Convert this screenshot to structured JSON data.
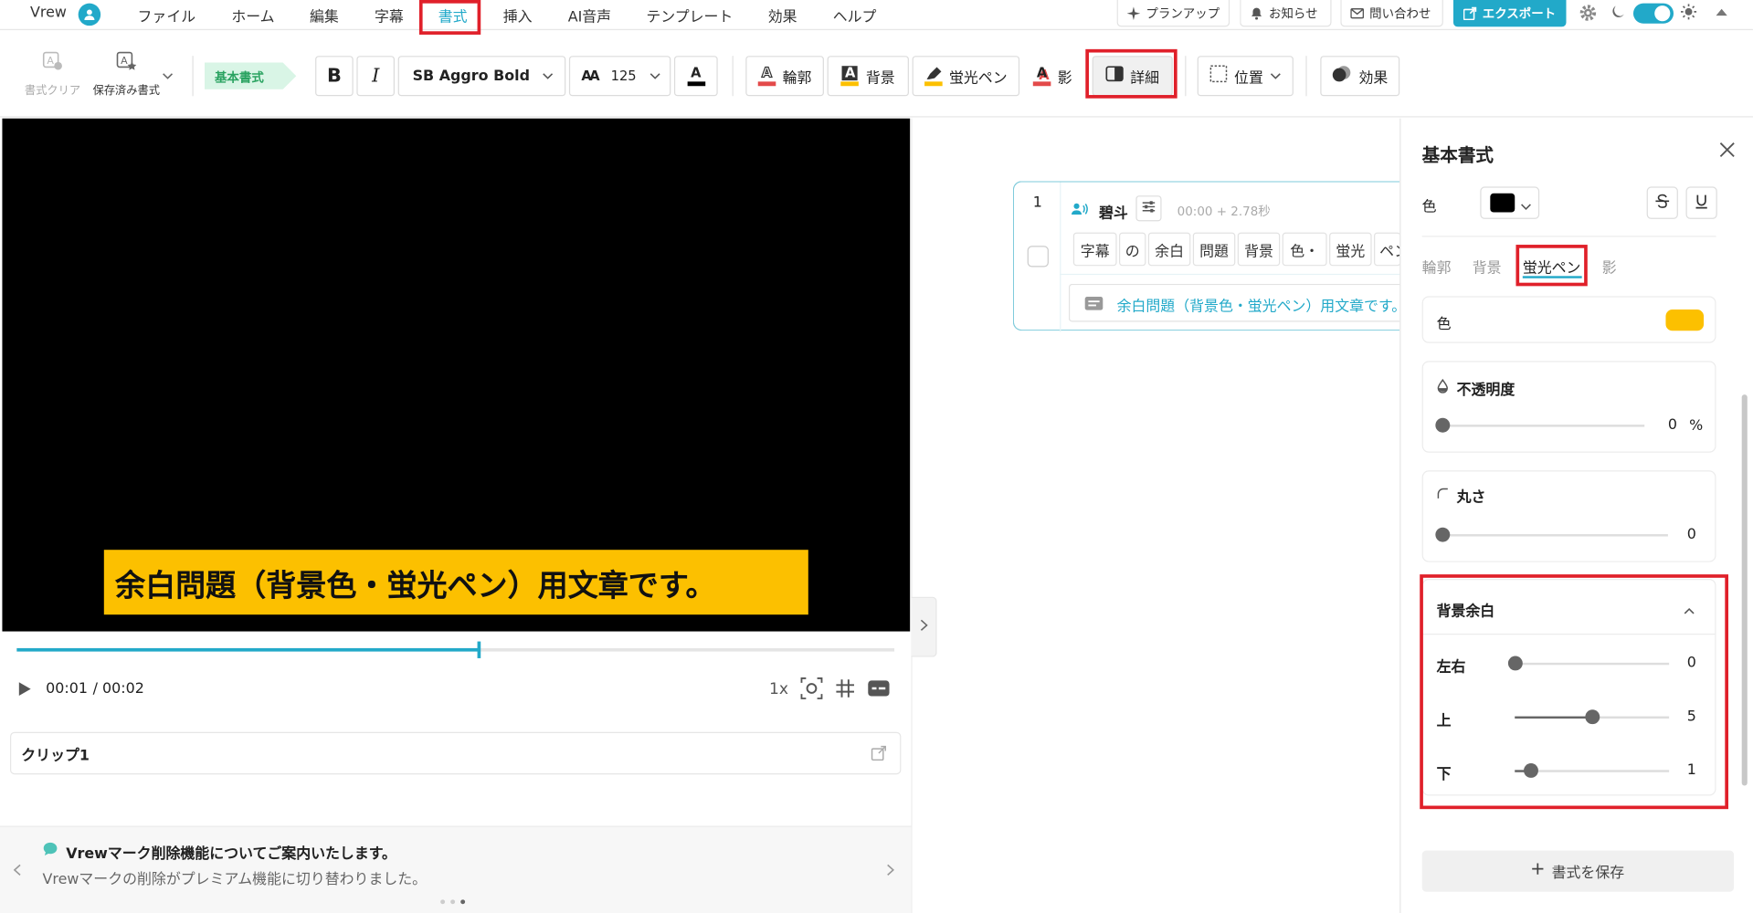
{
  "app": {
    "name": "Vrew"
  },
  "menu": {
    "items": [
      "ファイル",
      "ホーム",
      "編集",
      "字幕",
      "書式",
      "挿入",
      "AI音声",
      "テンプレート",
      "効果",
      "ヘルプ"
    ],
    "active": "書式"
  },
  "top_buttons": {
    "plan_up": "プランアップ",
    "notice": "お知らせ",
    "contact": "問い合わせ",
    "export": "エクスポート"
  },
  "toolbar": {
    "clear_format": "書式クリア",
    "saved_format": "保存済み書式",
    "preset_tag": "基本書式",
    "bold": "B",
    "italic": "I",
    "font": "SB Aggro Bold",
    "font_size_icon": "AA",
    "font_size": "125",
    "text_color_letter": "A",
    "outline": "輪郭",
    "background": "背景",
    "highlighter": "蛍光ペン",
    "shadow": "影",
    "detail": "詳細",
    "position": "位置",
    "effect": "効果"
  },
  "video": {
    "subtitle": "余白問題（背景色・蛍光ペン）用文章です。"
  },
  "player": {
    "current_time": "00:01",
    "total_time": "/ 00:02",
    "speed": "1x",
    "progress": 0.526
  },
  "clip": {
    "name": "クリップ1"
  },
  "notice": {
    "title": "Vrewマーク削除機能についてご案内いたします。",
    "body": "Vrewマークの削除がプレミアム機能に切り替わりました。"
  },
  "row": {
    "index": "1",
    "speaker": "碧斗",
    "timing": "00:00 + 2.78秒",
    "words": [
      "字幕",
      "の",
      "余白",
      "問題",
      "背景",
      "色・",
      "蛍光",
      "ペン"
    ],
    "text": "余白問題（背景色・蛍光ペン）用文章です。"
  },
  "panel": {
    "title": "基本書式",
    "color_label": "色",
    "color_value": "#000000",
    "tabs": [
      "輪郭",
      "背景",
      "蛍光ペン",
      "影"
    ],
    "active_tab": "蛍光ペン",
    "hl_color_label": "色",
    "hl_color_value": "#fcc000",
    "opacity": {
      "label": "不透明度",
      "value": "0",
      "unit": "%"
    },
    "roundness": {
      "label": "丸さ",
      "value": "0"
    },
    "padding": {
      "title": "背景余白",
      "horizontal": {
        "label": "左右",
        "value": "0",
        "fill": 0.0
      },
      "top": {
        "label": "上",
        "value": "5",
        "fill": 0.5
      },
      "bottom": {
        "label": "下",
        "value": "1",
        "fill": 0.1
      }
    },
    "save_button": "書式を保存"
  },
  "colors": {
    "accent": "#22a9c9",
    "highlight_red": "#e0202a",
    "highlighter": "#fcc000"
  }
}
